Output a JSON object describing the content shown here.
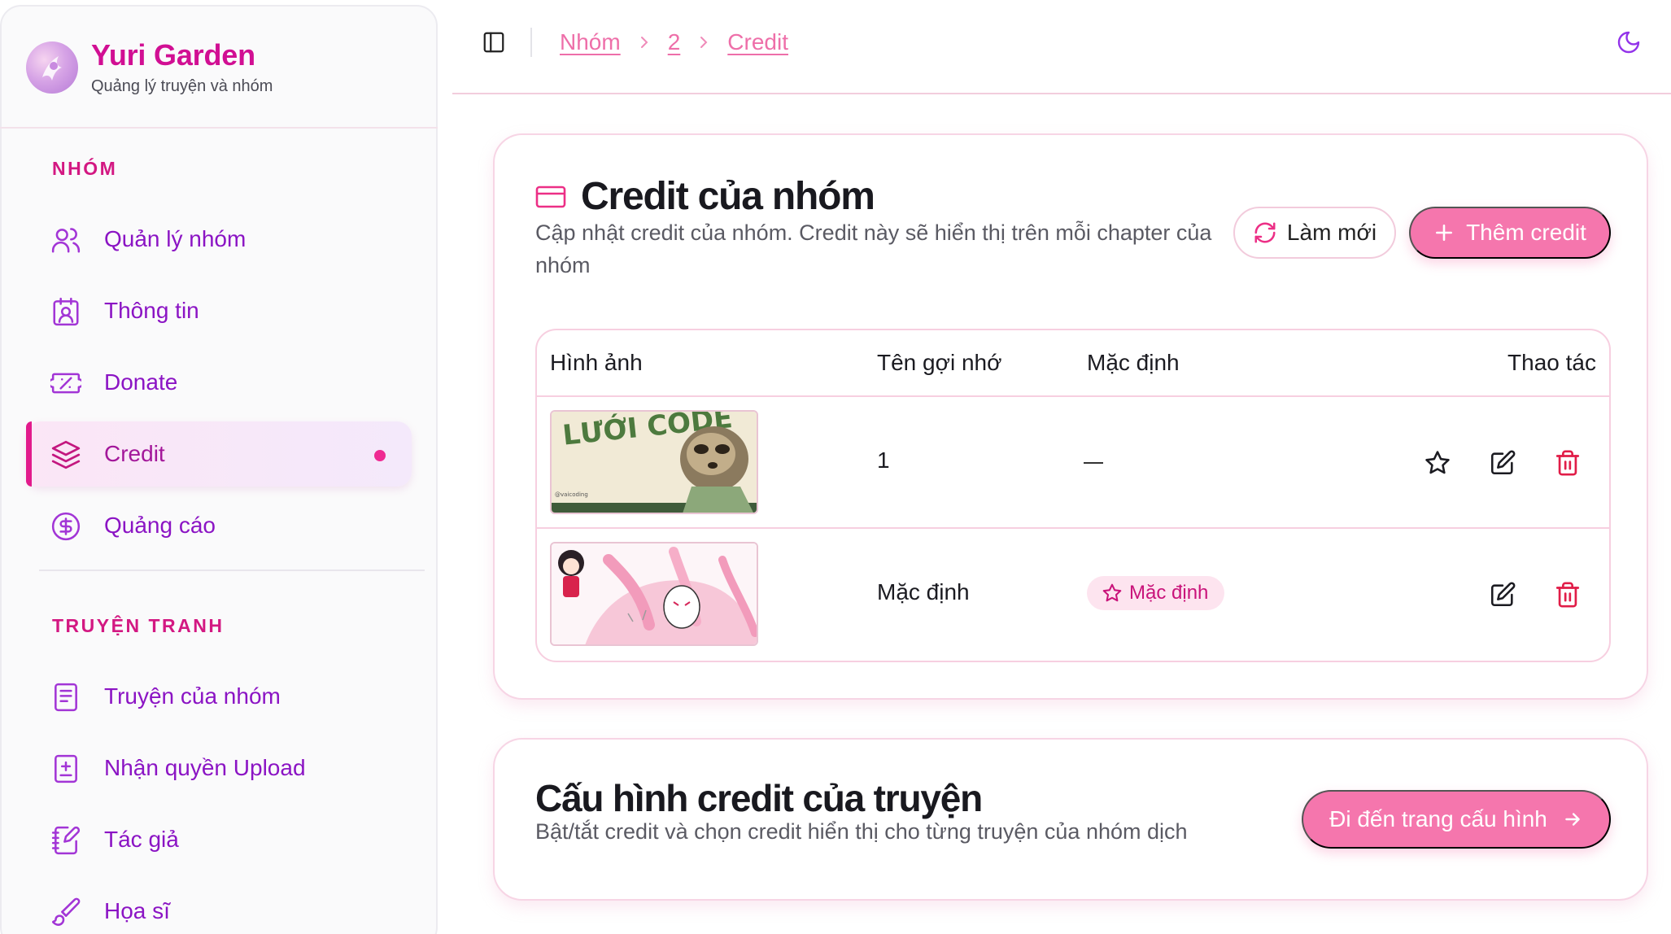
{
  "brand": {
    "title": "Yuri Garden",
    "subtitle": "Quảng lý truyện và nhóm"
  },
  "sidebar": {
    "sections": [
      {
        "label": "NHÓM",
        "items": [
          {
            "label": "Quản lý nhóm",
            "icon": "users-icon"
          },
          {
            "label": "Thông tin",
            "icon": "contact-card-icon"
          },
          {
            "label": "Donate",
            "icon": "ticket-icon"
          },
          {
            "label": "Credit",
            "icon": "layers-icon",
            "active": true
          },
          {
            "label": "Quảng cáo",
            "icon": "dollar-circle-icon"
          }
        ]
      },
      {
        "label": "TRUYỆN TRANH",
        "items": [
          {
            "label": "Truyện của nhóm",
            "icon": "book-icon"
          },
          {
            "label": "Nhận quyền Upload",
            "icon": "book-plus-icon"
          },
          {
            "label": "Tác giả",
            "icon": "notebook-pen-icon"
          },
          {
            "label": "Họa sĩ",
            "icon": "brush-icon"
          }
        ]
      }
    ]
  },
  "breadcrumb": [
    "Nhóm",
    "2",
    "Credit"
  ],
  "credit_card": {
    "title": "Credit của nhóm",
    "description": "Cập nhật credit của nhóm. Credit này sẽ hiển thị trên mỗi chapter của nhóm",
    "refresh_label": "Làm mới",
    "add_label": "Thêm credit",
    "table": {
      "headers": [
        "Hình ảnh",
        "Tên gợi nhớ",
        "Mặc định",
        "Thao tác"
      ],
      "rows": [
        {
          "image_text": "LƯỚI CODE",
          "image_caption": "@vaicoding",
          "name": "1",
          "default": false
        },
        {
          "image_text": "",
          "image_caption": "",
          "name": "Mặc định",
          "default": true,
          "badge": "Mặc định"
        }
      ]
    }
  },
  "config_card": {
    "title": "Cấu hình credit của truyện",
    "description": "Bật/tắt credit và chọn credit hiển thị cho từng truyện của nhóm dịch",
    "button_label": "Đi đến trang cấu hình"
  },
  "colors": {
    "brand": "#d10f93",
    "nav_text": "#8b14c4",
    "accent_pink": "#f576ad",
    "delete_red": "#e11d48"
  }
}
